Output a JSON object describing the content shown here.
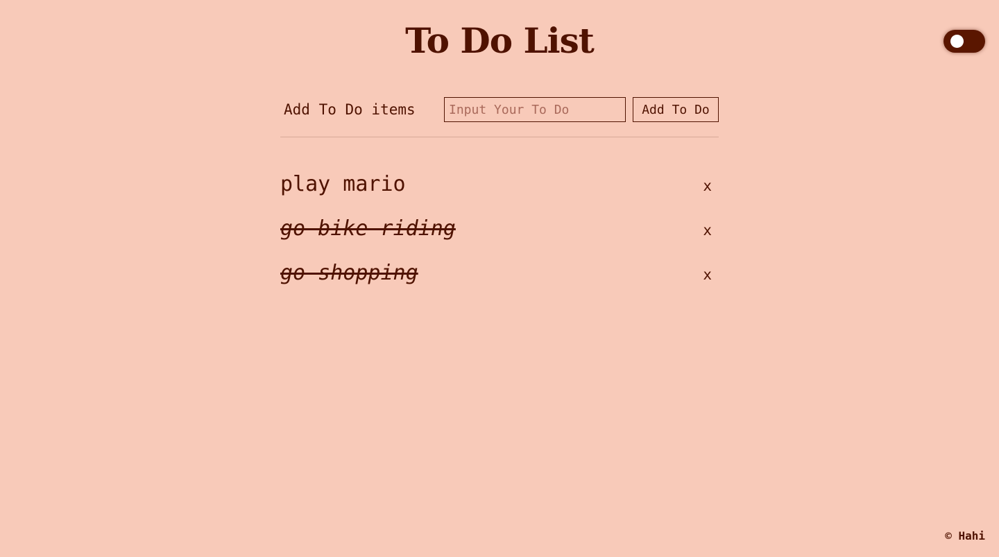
{
  "header": {
    "title": "To Do List"
  },
  "theme_toggle": {
    "track_color": "#5a1600",
    "knob_color": "#ffffff"
  },
  "add_form": {
    "label": "Add To Do items",
    "input_placeholder": "Input Your To Do",
    "input_value": "",
    "button_label": "Add To Do"
  },
  "todos": [
    {
      "text": "play mario",
      "completed": false,
      "delete_label": "x"
    },
    {
      "text": "go bike riding",
      "completed": true,
      "delete_label": "x"
    },
    {
      "text": "go shopping",
      "completed": true,
      "delete_label": "x"
    }
  ],
  "footer": {
    "text": "© Hahi"
  },
  "colors": {
    "background": "#f8cab9",
    "text": "#4f1200"
  }
}
